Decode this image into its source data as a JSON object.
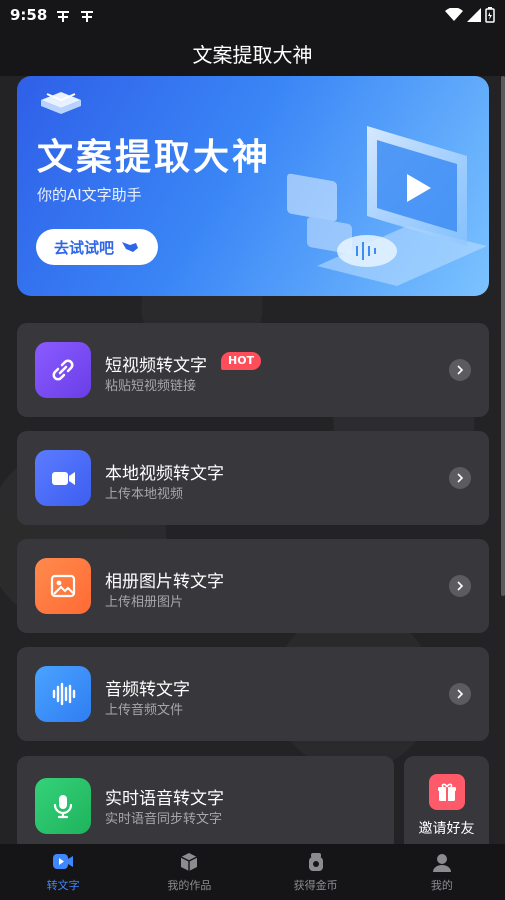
{
  "status": {
    "time": "9:58"
  },
  "header": {
    "title": "文案提取大神"
  },
  "banner": {
    "title": "文案提取大神",
    "subtitle": "你的AI文字助手",
    "button": "去试试吧"
  },
  "features": [
    {
      "name": "短视频转文字",
      "desc": "粘贴短视频链接",
      "badge": "HOT",
      "color": "#7b4cf5",
      "icon": "link-icon"
    },
    {
      "name": "本地视频转文字",
      "desc": "上传本地视频",
      "color": "#4a6cf7",
      "icon": "video-camera-icon"
    },
    {
      "name": "相册图片转文字",
      "desc": "上传相册图片",
      "color": "#ff7a3d",
      "icon": "image-icon"
    },
    {
      "name": "音频转文字",
      "desc": "上传音频文件",
      "color": "#3b8cf5",
      "icon": "audio-wave-icon"
    },
    {
      "name": "实时语音转文字",
      "desc": "实时语音同步转文字",
      "color": "#27c46a",
      "icon": "microphone-icon"
    }
  ],
  "invite": {
    "label": "邀请好友"
  },
  "tabs": [
    {
      "label": "转文字",
      "active": true
    },
    {
      "label": "我的作品"
    },
    {
      "label": "获得金币"
    },
    {
      "label": "我的"
    }
  ]
}
